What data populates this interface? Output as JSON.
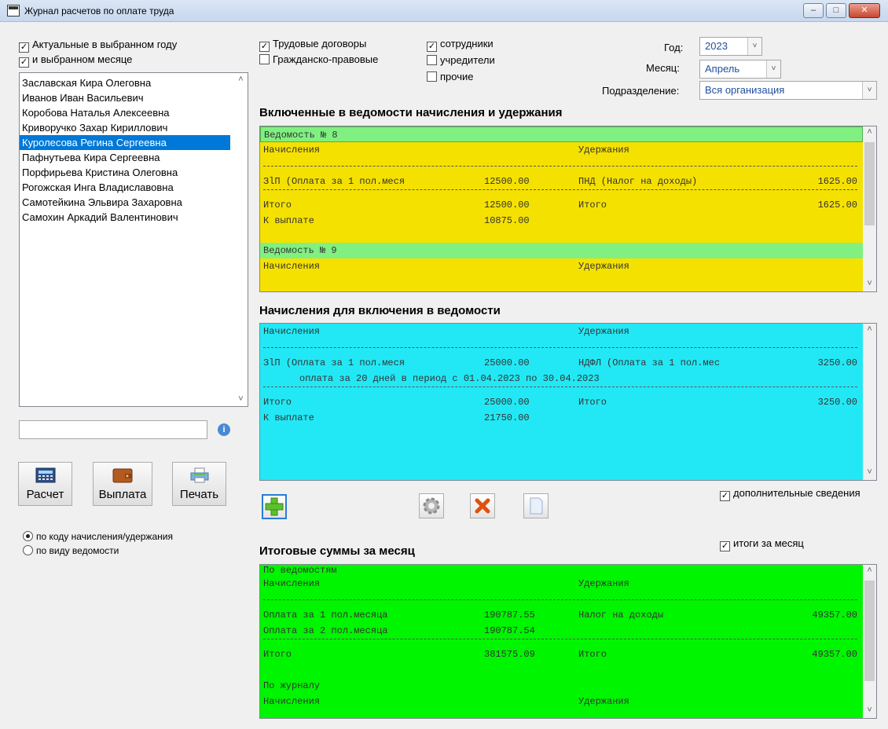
{
  "window": {
    "title": "Журнал расчетов по оплате труда",
    "min": "–",
    "max": "□",
    "close": "✕"
  },
  "filters": {
    "actual_year": "Актуальные в выбранном году",
    "selected_month": "и выбранном месяце",
    "labor_contracts": "Трудовые договоры",
    "civil_contracts": "Гражданско-правовые",
    "employees": "сотрудники",
    "founders": "учредители",
    "others": "прочие"
  },
  "period": {
    "year_label": "Год:",
    "year_value": "2023",
    "month_label": "Месяц:",
    "month_value": "Апрель",
    "dept_label": "Подразделение:",
    "dept_value": "Вся организация"
  },
  "persons": [
    "Заславская Кира Олеговна",
    "Иванов Иван Васильевич",
    "Коробова Наталья Алексеевна",
    "Криворучко Захар Кириллович",
    "Куролесова Регина Сергеевна",
    "Пафнутьева Кира Сергеевна",
    "Порфирьева Кристина Олеговна",
    "Рогожская Инга Владиславовна",
    "Самотейкина Эльвира Захаровна",
    "Самохин Аркадий Валентинович"
  ],
  "selected_person_index": 4,
  "buttons": {
    "calc": "Расчет",
    "pay": "Выплата",
    "print": "Печать"
  },
  "group_mode": {
    "by_code": "по коду начисления/удержания",
    "by_statement": "по виду ведомости"
  },
  "sections": {
    "included": "Включенные в ведомости начисления и удержания",
    "to_include": "Начисления для включения в ведомости",
    "totals": "Итоговые суммы за месяц"
  },
  "options": {
    "additional": "дополнительные сведения",
    "month_totals": "итоги за месяц"
  },
  "included": {
    "s8_header": "Ведомость № 8",
    "h_accr": "Начисления",
    "h_ded": "Удержания",
    "r1_name": "ЗlП (Оплата за 1 пол.меся",
    "r1_sum": "12500.00",
    "r1_ded": "ПНД (Налог на доходы)",
    "r1_dsum": "1625.00",
    "tot_label": "Итого",
    "tot_sum": "12500.00",
    "tot_ded_label": "Итого",
    "tot_dsum": "1625.00",
    "pay_label": "К выплате",
    "pay_sum": "10875.00",
    "s9_header": "Ведомость № 9",
    "h2_accr": "Начисления",
    "h2_ded": "Удержания"
  },
  "to_include": {
    "h_accr": "Начисления",
    "h_ded": "Удержания",
    "r1_name": "ЗlП (Оплата за 1 пол.меся",
    "r1_sum": "25000.00",
    "r1_ded": "НДФЛ (Оплата за 1 пол.мес",
    "r1_dsum": "3250.00",
    "r1_note": "оплата за 20 дней в период с 01.04.2023 по 30.04.2023",
    "tot_label": "Итого",
    "tot_sum": "25000.00",
    "tot_ded_label": "Итого",
    "tot_dsum": "3250.00",
    "pay_label": "К выплате",
    "pay_sum": "21750.00"
  },
  "totals": {
    "by_statements": "По ведомостям",
    "h_accr": "Начисления",
    "h_ded": "Удержания",
    "r1_name": "Оплата за 1 пол.месяца",
    "r1_sum": "190787.55",
    "r1_ded": "Налог на доходы",
    "r1_dsum": "49357.00",
    "r2_name": "Оплата за 2 пол.месяца",
    "r2_sum": "190787.54",
    "tot_label": "Итого",
    "tot_sum": "381575.09",
    "tot_ded_label": "Итого",
    "tot_dsum": "49357.00",
    "by_journal": "По журналу",
    "h2_accr": "Начисления",
    "h2_ded": "Удержания"
  },
  "colors": {
    "statement_header": "#80f080",
    "statement_body": "#f5e100",
    "pending": "#22e8f5",
    "totals": "#00f500",
    "selection": "#0078d7"
  }
}
